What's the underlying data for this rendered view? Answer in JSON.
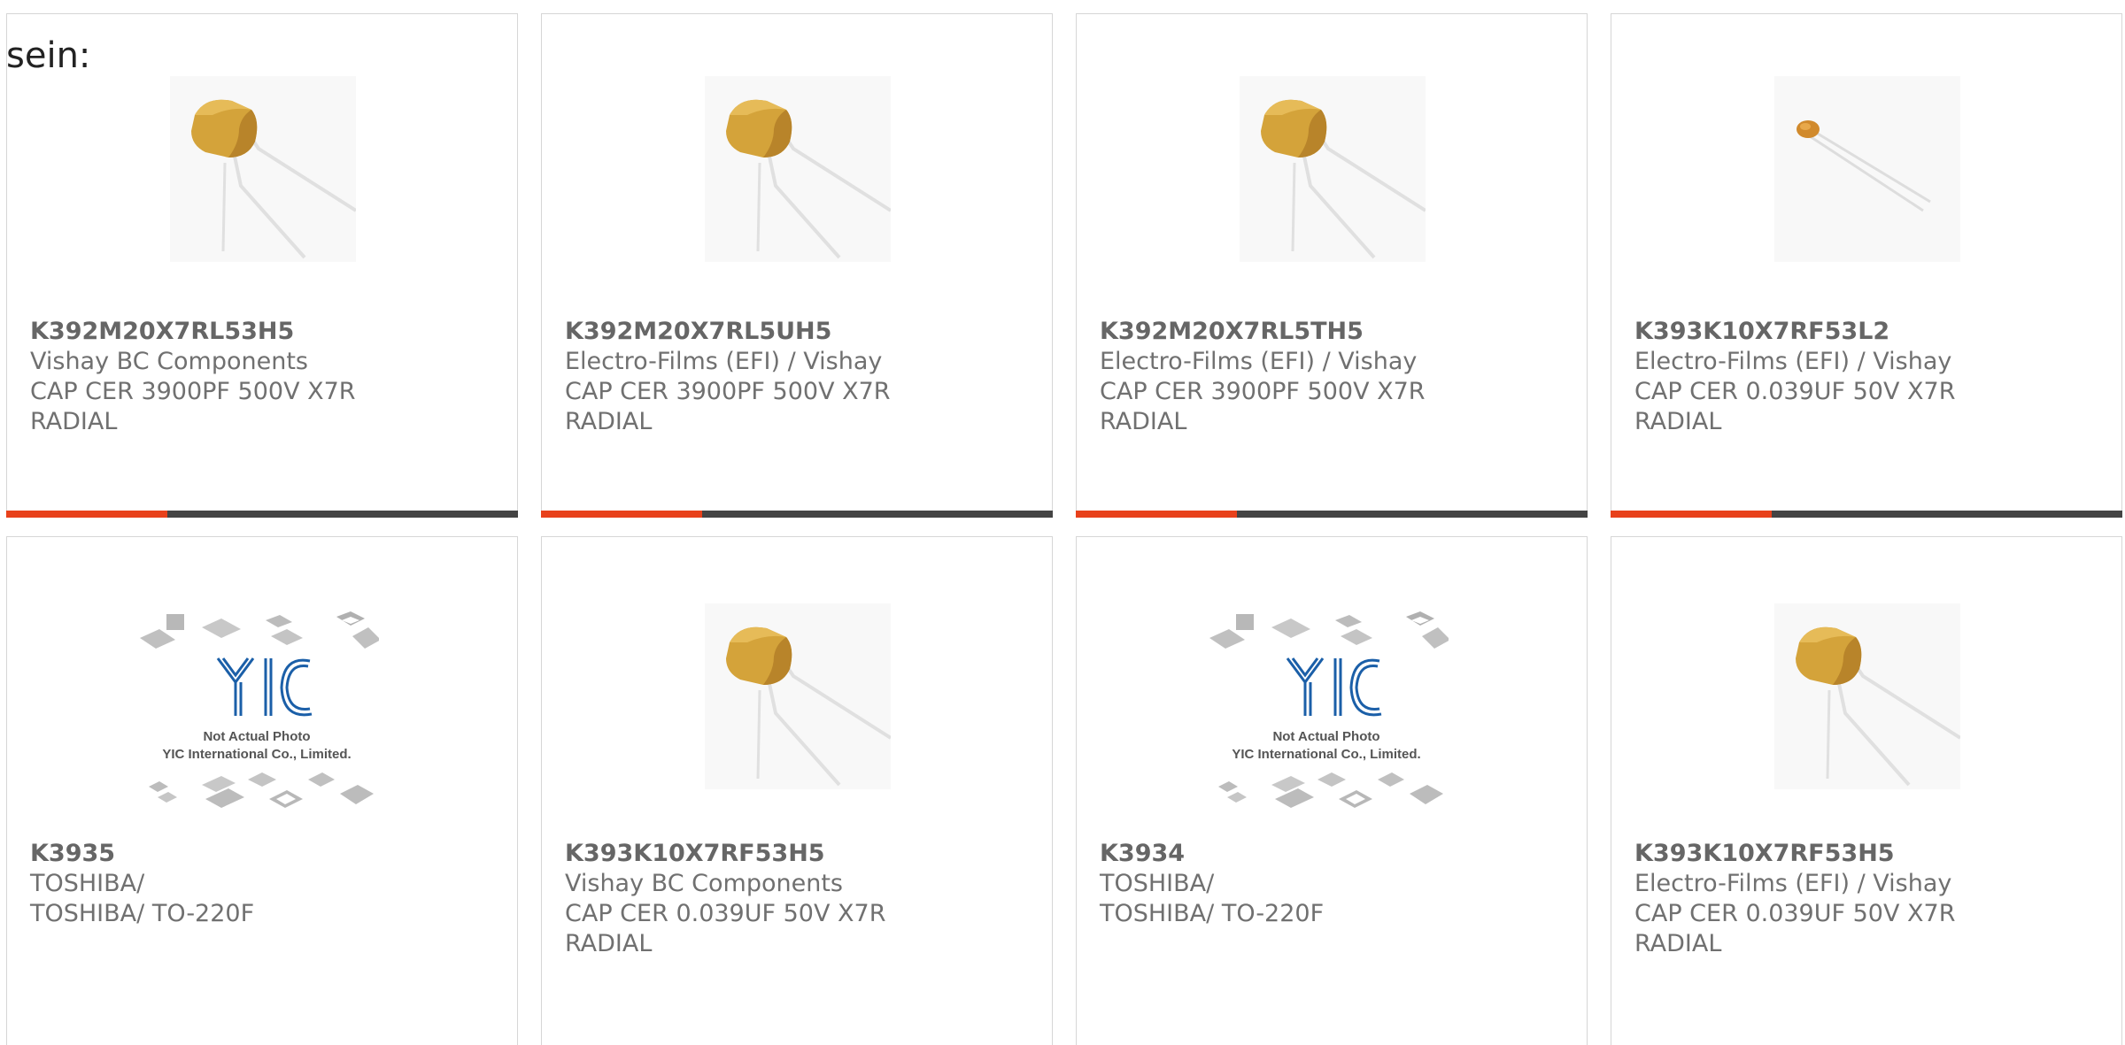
{
  "intro_text": "sein:",
  "colors": {
    "accent": "#e8411b",
    "bar": "#444444",
    "border": "#d6d6d6",
    "capacitor_body": "#d4a33a"
  },
  "cards": [
    {
      "part_number": "K392M20X7RL53H5",
      "manufacturer": "Vishay BC Components",
      "desc1": "CAP CER 3900PF 500V X7R",
      "desc2": "RADIAL",
      "image": "capacitor-photo"
    },
    {
      "part_number": "K392M20X7RL5UH5",
      "manufacturer": "Electro-Films (EFI) / Vishay",
      "desc1": "CAP CER 3900PF 500V X7R",
      "desc2": "RADIAL",
      "image": "capacitor-photo"
    },
    {
      "part_number": "K392M20X7RL5TH5",
      "manufacturer": "Electro-Films (EFI) / Vishay",
      "desc1": "CAP CER 3900PF 500V X7R",
      "desc2": "RADIAL",
      "image": "capacitor-photo"
    },
    {
      "part_number": "K393K10X7RF53L2",
      "manufacturer": "Electro-Films (EFI) / Vishay",
      "desc1": "CAP CER 0.039UF 50V X7R",
      "desc2": "RADIAL",
      "image": "small-capacitor-photo"
    },
    {
      "part_number": "K3935",
      "manufacturer": "TOSHIBA/",
      "desc1": "TOSHIBA/ TO-220F",
      "image": "placeholder-photo",
      "placeholder_line1": "Not Actual Photo",
      "placeholder_line2": "YIC International Co., Limited."
    },
    {
      "part_number": "K393K10X7RF53H5",
      "manufacturer": "Vishay BC Components",
      "desc1": "CAP CER 0.039UF 50V X7R",
      "desc2": "RADIAL",
      "image": "capacitor-photo"
    },
    {
      "part_number": "K3934",
      "manufacturer": "TOSHIBA/",
      "desc1": "TOSHIBA/ TO-220F",
      "image": "placeholder-photo",
      "placeholder_line1": "Not Actual Photo",
      "placeholder_line2": "YIC International Co., Limited."
    },
    {
      "part_number": "K393K10X7RF53H5",
      "manufacturer": "Electro-Films (EFI) / Vishay",
      "desc1": "CAP CER 0.039UF 50V X7R",
      "desc2": "RADIAL",
      "image": "capacitor-photo"
    }
  ]
}
